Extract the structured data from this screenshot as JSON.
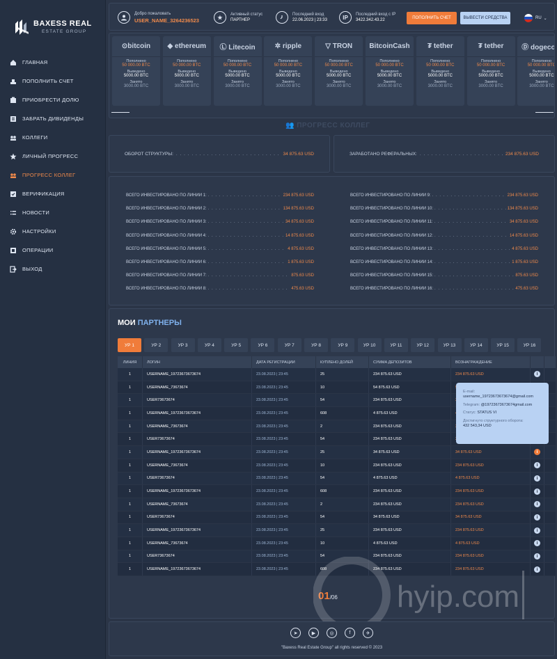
{
  "brand": {
    "title": "BAXESS REAL",
    "subtitle": "ESTATE GROUP"
  },
  "nav": [
    {
      "label": "ГЛАВНАЯ",
      "icon": "home-icon"
    },
    {
      "label": "ПОПОЛНИТЬ СЧЕТ",
      "icon": "deposit-icon"
    },
    {
      "label": "ПРИОБРЕСТИ ДОЛЮ",
      "icon": "share-icon"
    },
    {
      "label": "ЗАБРАТЬ ДИВИДЕНДЫ",
      "icon": "dividends-icon"
    },
    {
      "label": "КОЛЛЕГИ",
      "icon": "colleagues-icon"
    },
    {
      "label": "ЛИЧНЫЙ ПРОГРЕСС",
      "icon": "star-icon"
    },
    {
      "label": "ПРОГРЕСС КОЛЛЕГ",
      "icon": "team-icon",
      "active": true
    },
    {
      "label": "ВЕРИФИКАЦИЯ",
      "icon": "verification-icon"
    },
    {
      "label": "НОВОСТИ",
      "icon": "news-icon"
    },
    {
      "label": "НАСТРОЙКИ",
      "icon": "gear-icon"
    },
    {
      "label": "ОПЕРАЦИИ",
      "icon": "operations-icon"
    },
    {
      "label": "ВЫХОД",
      "icon": "logout-icon"
    }
  ],
  "topbar": {
    "welcome_label": "Добро пожаловать",
    "username": "USER_NAME_3264236523",
    "status_label": "Активный статус",
    "status_value": "ПАРТНЕР",
    "last_login_label": "Последний вход",
    "last_login_value": "22.06.2023 | 23:33",
    "last_ip_label": "Последний вход с IP",
    "last_ip_value": "3422.342.43.22",
    "ip_badge": "IP",
    "deposit_button": "ПОПОЛНИТЬ СЧЕТ",
    "withdraw_button": "ВЫВЕСТИ СРЕДСТВА",
    "language": "RU",
    "colors": {
      "accent": "#f07c3a",
      "secondary": "#b9d2f3"
    }
  },
  "crypto": {
    "cards": [
      {
        "name": "bitcoin",
        "logo_text": "⊙bitcoin"
      },
      {
        "name": "ethereum",
        "logo_text": "◆ ethereum"
      },
      {
        "name": "Litecoin",
        "logo_text": "Ⓛ Litecoin"
      },
      {
        "name": "ripple",
        "logo_text": "✲ ripple"
      },
      {
        "name": "TRON",
        "logo_text": "▽ TRON"
      },
      {
        "name": "BitcoinCash",
        "logo_text": "BitcoinCash"
      },
      {
        "name": "tether TRC20",
        "logo_text": "₮ tether"
      },
      {
        "name": "tether ERC20",
        "logo_text": "₮ tether"
      },
      {
        "name": "dogecoin",
        "logo_text": "Ⓓ dogecoin"
      }
    ],
    "deposited_label": "Пополнено",
    "deposited_value": "50 000.00 BTC",
    "withdrawn_label": "Выведено",
    "withdrawn_value": "5000.00 BTC",
    "taken_label": "Занято",
    "taken_value": "3000.00 BTC"
  },
  "colleagues_progress_title": "ПРОГРЕСС КОЛЛЕГ",
  "stats": {
    "turnover_label": "ОБОРОТ СТРУКТУРЫ:",
    "turnover_value": "34 875.63 USD",
    "referral_label": "ЗАРАБОТАНО РЕФЕРАЛЬНЫХ:",
    "referral_value": "234 875.63 USD"
  },
  "lines": [
    {
      "label": "ВСЕГО ИНВЕСТИРОВАНО ПО ЛИНИИ 1:",
      "value": "234 875.63 USD"
    },
    {
      "label": "ВСЕГО ИНВЕСТИРОВАНО ПО ЛИНИИ 2:",
      "value": "134 875.63 USD"
    },
    {
      "label": "ВСЕГО ИНВЕСТИРОВАНО ПО ЛИНИИ 3:",
      "value": "34 875.63 USD"
    },
    {
      "label": "ВСЕГО ИНВЕСТИРОВАНО ПО ЛИНИИ 4:",
      "value": "14 875.63 USD"
    },
    {
      "label": "ВСЕГО ИНВЕСТИРОВАНО ПО ЛИНИИ 5:",
      "value": "4 875.63 USD"
    },
    {
      "label": "ВСЕГО ИНВЕСТИРОВАНО ПО ЛИНИИ 6:",
      "value": "1 875.63 USD"
    },
    {
      "label": "ВСЕГО ИНВЕСТИРОВАНО ПО ЛИНИИ 7:",
      "value": "875.63 USD"
    },
    {
      "label": "ВСЕГО ИНВЕСТИРОВАНО ПО ЛИНИИ 8:",
      "value": "475.63 USD"
    },
    {
      "label": "ВСЕГО ИНВЕСТИРОВАНО ПО ЛИНИИ 9:",
      "value": "234 875.63 USD"
    },
    {
      "label": "ВСЕГО ИНВЕСТИРОВАНО ПО ЛИНИИ 10:",
      "value": "134 875.63 USD"
    },
    {
      "label": "ВСЕГО ИНВЕСТИРОВАНО ПО ЛИНИИ 11:",
      "value": "34 875.63 USD"
    },
    {
      "label": "ВСЕГО ИНВЕСТИРОВАНО ПО ЛИНИИ 12:",
      "value": "14 875.63 USD"
    },
    {
      "label": "ВСЕГО ИНВЕСТИРОВАНО ПО ЛИНИИ 13:",
      "value": "4 875.63 USD"
    },
    {
      "label": "ВСЕГО ИНВЕСТИРОВАНО ПО ЛИНИИ 14:",
      "value": "1 875.63 USD"
    },
    {
      "label": "ВСЕГО ИНВЕСТИРОВАНО ПО ЛИНИИ 15:",
      "value": "875.63 USD"
    },
    {
      "label": "ВСЕГО ИНВЕСТИРОВАНО ПО ЛИНИИ 16:",
      "value": "475.63 USD"
    }
  ],
  "partners": {
    "title_a": "МОИ",
    "title_b": "ПАРТНЕРЫ",
    "tabs": [
      "УР 1",
      "УР 2",
      "УР 3",
      "УР 4",
      "УР 5",
      "УР 6",
      "УР 7",
      "УР 8",
      "УР 9",
      "УР 10",
      "УР 11",
      "УР 12",
      "УР 13",
      "УР 14",
      "УР 15",
      "УР 16"
    ],
    "columns": [
      "ЛИНИЯ",
      "ЛОГИН",
      "ДАТА РЕГИСТРАЦИИ",
      "КУПЛЕНО ДОЛЕЙ",
      "СУММА ДЕПОЗИТОВ",
      "ВОЗНАГРАЖДЕНИЕ"
    ],
    "rows": [
      [
        "1",
        "USERNAME_19723673673674",
        "23.08.2023 | 23:45",
        "25",
        "234 875.63 USD",
        "234 875.63 USD"
      ],
      [
        "1",
        "USERNAME_73673674",
        "23.08.2023 | 23:45",
        "10",
        "54 875.63 USD",
        "54 875.63 USD"
      ],
      [
        "1",
        "USER73673674",
        "23.08.2023 | 23:45",
        "54",
        "234 875.63 USD",
        "34 875.63 USD"
      ],
      [
        "1",
        "USERNAME_19723673673674",
        "23.08.2023 | 23:45",
        "608",
        "4 875.63 USD",
        "4 875.63 USD"
      ],
      [
        "1",
        "USERNAME_73673674",
        "23.08.2023 | 23:45",
        "2",
        "234 875.63 USD",
        "234 875.63 USD"
      ],
      [
        "1",
        "USER73673674",
        "23.08.2023 | 23:45",
        "54",
        "234 875.63 USD",
        "234 875.63 USD"
      ],
      [
        "1",
        "USERNAME_19723673673674",
        "23.08.2023 | 23:45",
        "25",
        "34 875.63 USD",
        "34 875.63 USD"
      ],
      [
        "1",
        "USERNAME_73673674",
        "23.08.2023 | 23:45",
        "10",
        "234 875.63 USD",
        "234 875.63 USD"
      ],
      [
        "1",
        "USER73673674",
        "23.08.2023 | 23:45",
        "54",
        "4 875.63 USD",
        "4 875.63 USD"
      ],
      [
        "1",
        "USERNAME_19723673673674",
        "23.08.2023 | 23:45",
        "608",
        "234 875.63 USD",
        "234 875.63 USD"
      ],
      [
        "1",
        "USERNAME_73673674",
        "23.08.2023 | 23:45",
        "2",
        "234 875.63 USD",
        "234 875.63 USD"
      ],
      [
        "1",
        "USER73673674",
        "23.08.2023 | 23:45",
        "54",
        "34 875.63 USD",
        "34 875.63 USD"
      ],
      [
        "1",
        "USERNAME_19723673673674",
        "23.08.2023 | 23:45",
        "25",
        "234 875.63 USD",
        "234 875.63 USD"
      ],
      [
        "1",
        "USERNAME_73673674",
        "23.08.2023 | 23:45",
        "10",
        "4 875.63 USD",
        "4 875.63 USD"
      ],
      [
        "1",
        "USER73673674",
        "23.08.2023 | 23:45",
        "54",
        "234 875.63 USD",
        "234 875.63 USD"
      ],
      [
        "1",
        "USERNAME_19723673673674",
        "23.08.2023 | 23:45",
        "608",
        "234 875.63 USD",
        "234 875.63 USD"
      ]
    ],
    "tooltip": {
      "email_label": "E-mail:",
      "email_value": "username_19723673673674@gmail.com",
      "telegram_label": "Telegram:",
      "telegram_value": "@19723673673674gmail.com",
      "status_label": "Статус:",
      "status_value": "STATUS VI",
      "turnover_label": "Достигнуто структурного оборота:",
      "turnover_value": "432 543,34 USD"
    },
    "page_current": "01",
    "page_total": "/06"
  },
  "watermark_text": "hyip.com",
  "footer": {
    "socials": [
      "telegram-icon",
      "youtube-icon",
      "instagram-icon",
      "facebook-icon",
      "send-icon"
    ],
    "copyright": "\"Baxess Real Estate Group\" all rights reserved © 2023"
  }
}
